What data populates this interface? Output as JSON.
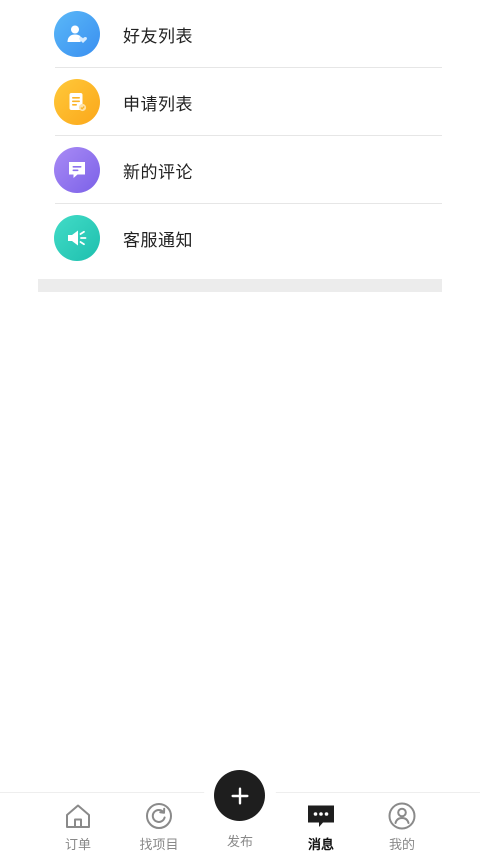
{
  "menu": {
    "items": [
      {
        "label": "好友列表",
        "icon": "friends-icon",
        "color_from": "#5ab8f8",
        "color_to": "#3a8ff0"
      },
      {
        "label": "申请列表",
        "icon": "application-icon",
        "color_from": "#ffc93a",
        "color_to": "#fba71a"
      },
      {
        "label": "新的评论",
        "icon": "comment-icon",
        "color_from": "#a98bf5",
        "color_to": "#7b61e8"
      },
      {
        "label": "客服通知",
        "icon": "speaker-icon",
        "color_from": "#42dcc7",
        "color_to": "#1ebfae"
      }
    ]
  },
  "tabbar": {
    "tabs": [
      {
        "label": "订单",
        "icon": "home-icon"
      },
      {
        "label": "找项目",
        "icon": "refresh-icon"
      },
      {
        "label": "发布",
        "icon": "plus-icon"
      },
      {
        "label": "消息",
        "icon": "message-icon",
        "active": true
      },
      {
        "label": "我的",
        "icon": "profile-icon"
      }
    ]
  }
}
